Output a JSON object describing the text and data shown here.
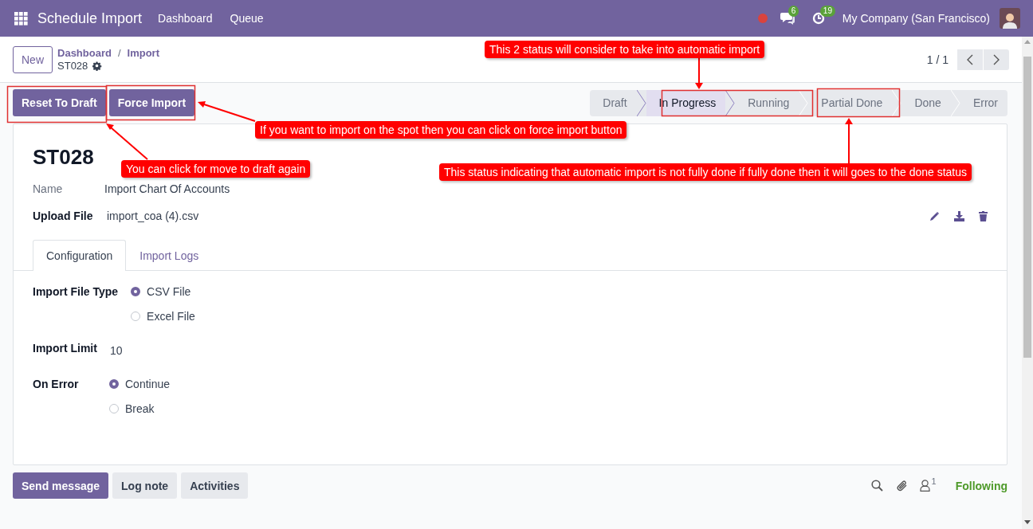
{
  "navbar": {
    "app_title": "Schedule Import",
    "menus": [
      "Dashboard",
      "Queue"
    ],
    "messages_count": "6",
    "activities_count": "19",
    "company": "My Company (San Francisco)"
  },
  "control_panel": {
    "new_button": "New",
    "breadcrumbs": [
      "Dashboard",
      "Import"
    ],
    "breadcrumb_separator": "/",
    "record": "ST028",
    "pager": "1 / 1"
  },
  "header_buttons": [
    "Reset To Draft",
    "Force Import"
  ],
  "statusbar": [
    {
      "label": "Draft",
      "selected": false
    },
    {
      "label": "In Progress",
      "selected": true
    },
    {
      "label": "Running",
      "selected": false
    },
    {
      "label": "Partial Done",
      "selected": false
    },
    {
      "label": "Done",
      "selected": false
    },
    {
      "label": "Error",
      "selected": false
    }
  ],
  "form": {
    "title": "ST028",
    "fields": [
      {
        "kind": "char",
        "label": "Name",
        "value": "Import Chart Of Accounts"
      },
      {
        "kind": "binary",
        "label": "Upload File",
        "value": "import_coa (4).csv"
      }
    ],
    "tabs": [
      {
        "label": "Configuration",
        "selected": true
      },
      {
        "label": "Import Logs",
        "selected": false
      }
    ],
    "config": [
      {
        "kind": "radio",
        "label": "Import File Type",
        "options": [
          {
            "label": "CSV File",
            "selected": true
          },
          {
            "label": "Excel File",
            "selected": false
          }
        ]
      },
      {
        "kind": "number",
        "label": "Import Limit",
        "value": "10"
      },
      {
        "kind": "radio",
        "label": "On Error",
        "options": [
          {
            "label": "Continue",
            "selected": true
          },
          {
            "label": "Break",
            "selected": false
          }
        ]
      }
    ]
  },
  "chatter": {
    "buttons": [
      {
        "kind": "primary",
        "label": "Send message"
      },
      {
        "kind": "secondary",
        "label": "Log note"
      },
      {
        "kind": "secondary",
        "label": "Activities"
      }
    ],
    "followers_count": "1",
    "following": "Following"
  },
  "annotations": [
    {
      "text": "This 2 status will consider to take into automatic import"
    },
    {
      "text": "If you want to import on the spot then you can click on force import button"
    },
    {
      "text": "You can click for move to draft again"
    },
    {
      "text": "This status indicating that automatic import is not fully done if fully done then it will goes to the done status"
    }
  ]
}
